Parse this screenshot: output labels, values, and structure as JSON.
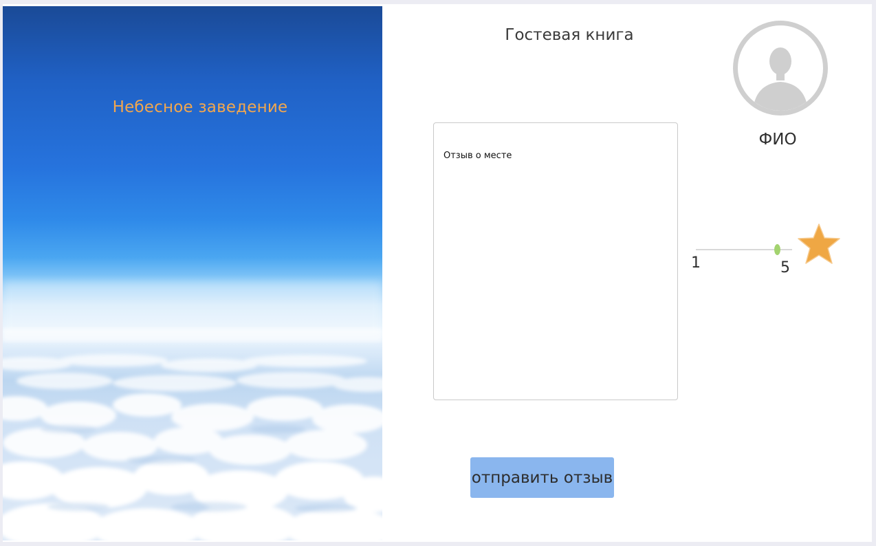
{
  "sky_panel": {
    "title": "Небесное заведение"
  },
  "guestbook": {
    "title": "Гостевая книга"
  },
  "profile": {
    "avatar_icon": "user-silhouette-icon",
    "name_label": "ФИО"
  },
  "review": {
    "placeholder": "Отзыв о месте"
  },
  "rating": {
    "min_label": "1",
    "max_label": "5",
    "value_fraction": 0.82,
    "star_icon": "star-icon",
    "thumb_color": "#a3d36f",
    "star_color": "#efa744"
  },
  "actions": {
    "submit_label": "отправить отзыв",
    "submit_color": "#8ab6ee"
  },
  "colors": {
    "accent_title": "#f2a74e",
    "avatar_ring": "#cfcfcf"
  }
}
